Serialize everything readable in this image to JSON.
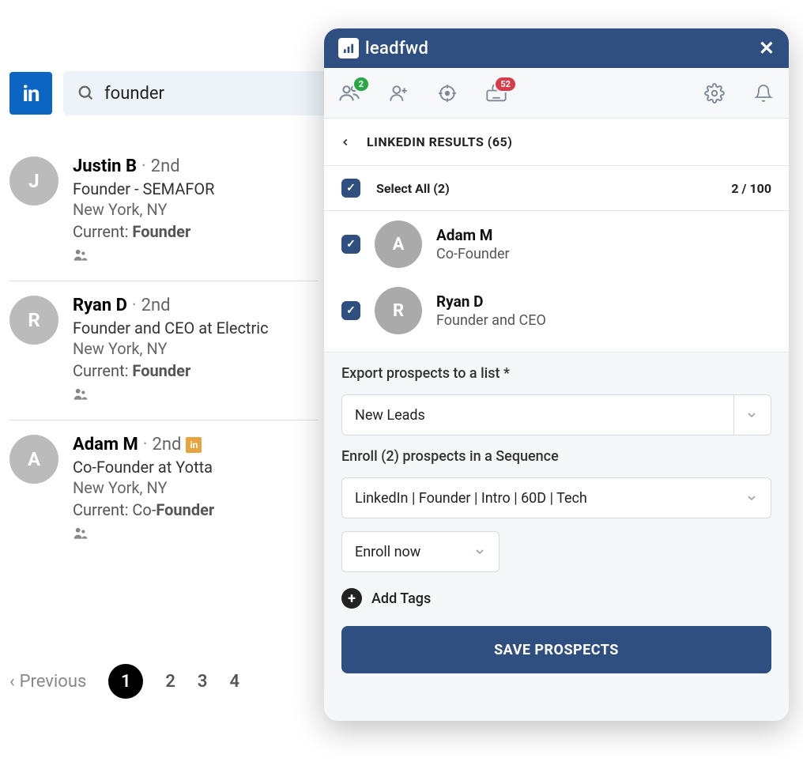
{
  "linkedin": {
    "search_value": "founder",
    "results": [
      {
        "name": "Justin B",
        "degree": "2nd",
        "badge": false,
        "title": "Founder - SEMAFOR",
        "location": "New York, NY",
        "current_prefix": "Current: ",
        "current_bold": "Founder",
        "initial": "J"
      },
      {
        "name": "Ryan D",
        "degree": "2nd",
        "badge": false,
        "title": "Founder and CEO at Electric",
        "location": "New York, NY",
        "current_prefix": "Current: ",
        "current_bold": "Founder",
        "initial": "R"
      },
      {
        "name": "Adam M",
        "degree": "2nd",
        "badge": true,
        "title": "Co-Founder at Yotta",
        "location": "New York, NY",
        "current_prefix": "Current: Co-",
        "current_bold": "Founder",
        "initial": "A"
      }
    ],
    "pagination": {
      "prev": "Previous",
      "pages": [
        "1",
        "2",
        "3",
        "4"
      ],
      "current": "1"
    }
  },
  "panel": {
    "brand": "leadfwd",
    "toolbar": {
      "contacts_badge": "2",
      "keyboard_badge": "52"
    },
    "crumb": "LINKEDIN RESULTS (65)",
    "select_all": {
      "label": "Select All (2)",
      "counter": "2 / 100"
    },
    "prospects": [
      {
        "name": "Adam M",
        "title": "Co-Founder",
        "initial": "A"
      },
      {
        "name": "Ryan D",
        "title": "Founder and CEO",
        "initial": "R"
      }
    ],
    "export_label": "Export prospects to a list *",
    "export_value": "New Leads",
    "enroll_label": "Enroll (2) prospects in a Sequence",
    "enroll_value": "LinkedIn | Founder | Intro | 60D | Tech",
    "enroll_timing": "Enroll now",
    "add_tags": "Add Tags",
    "save_button": "SAVE PROSPECTS"
  }
}
